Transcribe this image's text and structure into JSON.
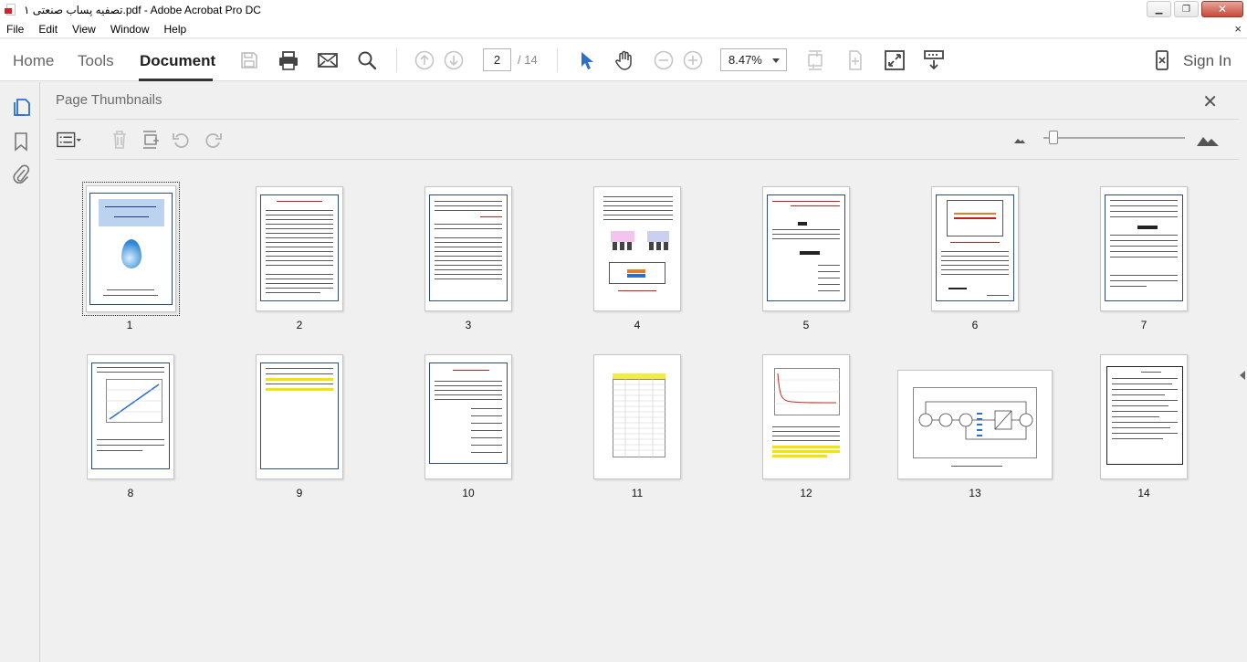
{
  "window": {
    "title": "تصفیه پساب صنعتی ۱.pdf - Adobe Acrobat Pro DC",
    "minimize": "▁",
    "restore": "❐",
    "close": "✕"
  },
  "menu": {
    "items": [
      "File",
      "Edit",
      "View",
      "Window",
      "Help"
    ],
    "close_glyph": "×"
  },
  "toolbar": {
    "tabs": [
      {
        "label": "Home"
      },
      {
        "label": "Tools"
      },
      {
        "label": "Document"
      }
    ],
    "active_tab": "Document",
    "current_page": "2",
    "page_total": "/ 14",
    "zoom": "8.47%",
    "sign_in": "Sign In"
  },
  "panel": {
    "title": "Page Thumbnails",
    "close_glyph": "✕"
  },
  "thumbnails": [
    {
      "label": "1"
    },
    {
      "label": "2"
    },
    {
      "label": "3"
    },
    {
      "label": "4"
    },
    {
      "label": "5"
    },
    {
      "label": "6"
    },
    {
      "label": "7"
    },
    {
      "label": "8"
    },
    {
      "label": "9"
    },
    {
      "label": "10"
    },
    {
      "label": "11"
    },
    {
      "label": "12"
    },
    {
      "label": "13"
    },
    {
      "label": "14"
    }
  ],
  "colors": {
    "frame": "#2e4d7a",
    "accent_blue": "#2b6fcf",
    "highlight": "#f2e600",
    "heading_red": "#c02020"
  }
}
